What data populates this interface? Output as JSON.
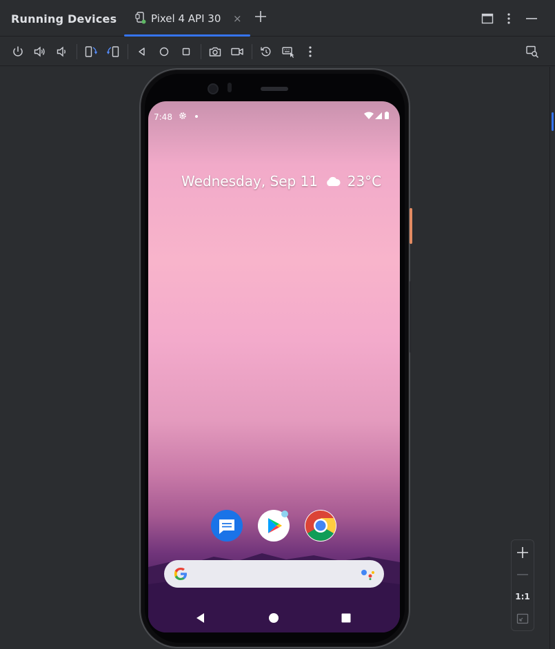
{
  "panel": {
    "title": "Running Devices"
  },
  "tabs": [
    {
      "label": "Pixel 4 API 30",
      "close": "×",
      "icon": "device-mirror-icon",
      "active": true
    }
  ],
  "header_buttons": [
    "add-tab-icon",
    "maximize-icon",
    "more-vert-icon",
    "minimize-icon"
  ],
  "toolbar": {
    "buttons": [
      "power-icon",
      "volume-up-icon",
      "volume-down-icon",
      "rotate-left-icon",
      "rotate-right-icon",
      "back-icon",
      "home-icon",
      "overview-icon",
      "screenshot-icon",
      "screen-record-icon",
      "reset-icon",
      "keyboard-input-icon",
      "more-vert-icon",
      "layout-inspector-icon"
    ]
  },
  "device": {
    "status_bar": {
      "time": "7:48"
    },
    "glance": {
      "date": "Wednesday, Sep 11",
      "temperature": "23°C",
      "weather_icon": "cloud-icon"
    },
    "dock": [
      "messages-app-icon",
      "play-store-app-icon",
      "chrome-app-icon"
    ],
    "search": {
      "logo": "google-g-icon",
      "assistant": "assistant-icon"
    },
    "nav": [
      "back-triangle-icon",
      "home-circle-icon",
      "recents-square-icon"
    ]
  },
  "zoom": {
    "zoom_in": "+",
    "zoom_out": "—",
    "actual_size": "1:1",
    "fit": "fit-screen-icon"
  },
  "colors": {
    "accent": "#3574f0",
    "background": "#2b2d30",
    "phone_side_button": "#e28b62"
  }
}
